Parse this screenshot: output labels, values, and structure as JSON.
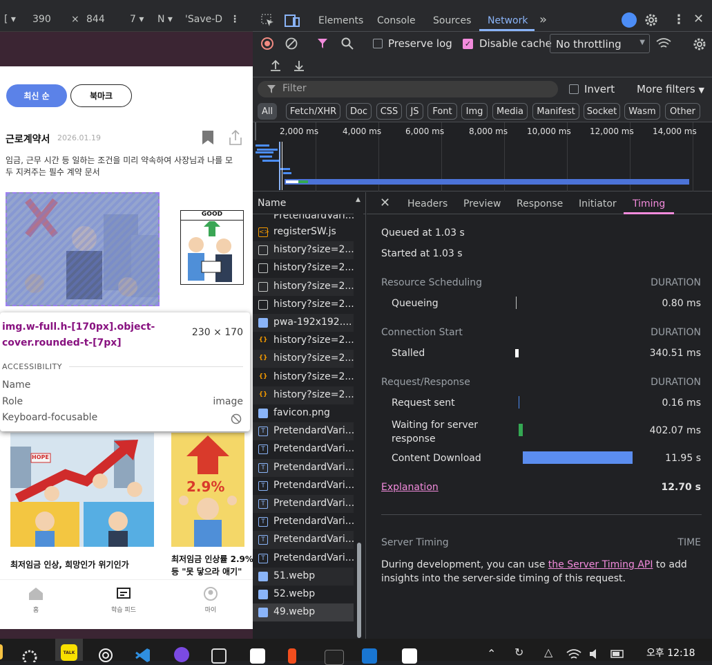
{
  "device_toolbar": {
    "dims_prefix": "[ ▾",
    "width": "390",
    "times": "×",
    "height": "844",
    "zoom": "7 ▾",
    "throttle": "N ▾",
    "save": "'Save-D",
    "more": "⋮"
  },
  "app": {
    "tabs": {
      "newest": "최신 순",
      "bookmark": "북마크"
    },
    "card": {
      "title": "근로계약서",
      "date": "2026.01.19",
      "description": "임금, 근무 시간 등 일하는 조건을 미리 약속하여 사장님과 나를 모두 지켜주는 필수 계약 문서"
    },
    "img2_label": "GOOD",
    "img3_sign": "HOPE",
    "img4_label": "2.9%",
    "captions": [
      "최저임금 인상, 희망인가 위기인가",
      "최저임금 인상률 2.9%",
      "등 \"못 닿으라 애기\""
    ],
    "nav": {
      "home": "홈",
      "feed": "학습 피드",
      "my": "마이"
    }
  },
  "inspector": {
    "selector": "img.w-full.h-[170px].object-cover.rounded-t-[7px]",
    "size": "230 × 170",
    "section": "ACCESSIBILITY",
    "name_label": "Name",
    "role_label": "Role",
    "role_value": "image",
    "focus_label": "Keyboard-focusable"
  },
  "devtools": {
    "tabs": [
      "Elements",
      "Console",
      "Sources",
      "Network"
    ],
    "active_tab": "Network",
    "more_tabs": "»",
    "preserve_log": "Preserve log",
    "disable_cache": "Disable cache",
    "throttling": "No throttling",
    "filter_placeholder": "Filter",
    "invert": "Invert",
    "more_filters": "More filters",
    "types": [
      "All",
      "Fetch/XHR",
      "Doc",
      "CSS",
      "JS",
      "Font",
      "Img",
      "Media",
      "Manifest",
      "Socket",
      "Wasm",
      "Other"
    ],
    "ticks": [
      "2,000 ms",
      "4,000 ms",
      "6,000 ms",
      "8,000 ms",
      "10,000 ms",
      "12,000 ms",
      "14,000 ms"
    ],
    "name_header": "Name",
    "requests": [
      {
        "type": "font",
        "name": "PretendardVari..."
      },
      {
        "type": "script",
        "name": "registerSW.js"
      },
      {
        "type": "doc",
        "name": "history?size=2..."
      },
      {
        "type": "doc",
        "name": "history?size=2..."
      },
      {
        "type": "doc",
        "name": "history?size=2..."
      },
      {
        "type": "doc",
        "name": "history?size=2..."
      },
      {
        "type": "img",
        "name": "pwa-192x192...."
      },
      {
        "type": "json",
        "name": "history?size=2..."
      },
      {
        "type": "json",
        "name": "history?size=2..."
      },
      {
        "type": "json",
        "name": "history?size=2..."
      },
      {
        "type": "json",
        "name": "history?size=2..."
      },
      {
        "type": "img",
        "name": "favicon.png"
      },
      {
        "type": "font",
        "name": "PretendardVari..."
      },
      {
        "type": "font",
        "name": "PretendardVari..."
      },
      {
        "type": "font",
        "name": "PretendardVari..."
      },
      {
        "type": "font",
        "name": "PretendardVari..."
      },
      {
        "type": "font",
        "name": "PretendardVari..."
      },
      {
        "type": "font",
        "name": "PretendardVari..."
      },
      {
        "type": "font",
        "name": "PretendardVari..."
      },
      {
        "type": "font",
        "name": "PretendardVari..."
      },
      {
        "type": "img",
        "name": "51.webp"
      },
      {
        "type": "img",
        "name": "52.webp"
      },
      {
        "type": "img",
        "name": "49.webp"
      }
    ],
    "detail_tabs": [
      "Headers",
      "Preview",
      "Response",
      "Initiator",
      "Timing"
    ],
    "active_detail_tab": "Timing",
    "timing": {
      "queued": "Queued at 1.03 s",
      "started": "Started at 1.03 s",
      "sections": {
        "scheduling": "Resource Scheduling",
        "connection": "Connection Start",
        "request": "Request/Response",
        "duration": "DURATION"
      },
      "rows": {
        "queueing": {
          "label": "Queueing",
          "value": "0.80 ms"
        },
        "stalled": {
          "label": "Stalled",
          "value": "340.51 ms"
        },
        "sent": {
          "label": "Request sent",
          "value": "0.16 ms"
        },
        "waiting": {
          "label": "Waiting for server response",
          "value": "402.07 ms"
        },
        "download": {
          "label": "Content Download",
          "value": "11.95 s"
        }
      },
      "explanation": "Explanation",
      "total": "12.70 s",
      "server_timing": "Server Timing",
      "time_label": "TIME",
      "server_note_1": "During development, you can use ",
      "server_note_link": "the Server Timing API",
      "server_note_2": " to add insights into the server-side timing of this request."
    }
  },
  "taskbar": {
    "clock": "오후 12:18"
  },
  "colors": {
    "accent": "#8ab4f8",
    "active_tab": "#f28bdc",
    "download_bar": "#5b8def",
    "waiting_bar": "#34a853"
  }
}
